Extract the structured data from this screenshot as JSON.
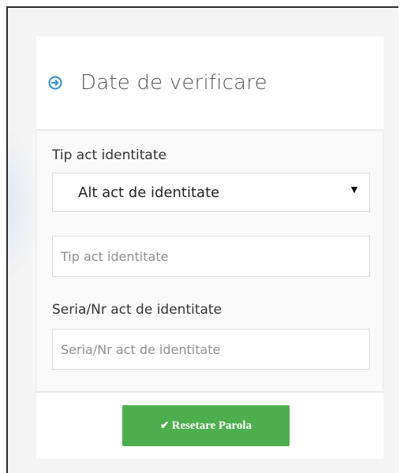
{
  "header": {
    "icon": "arrow-circle-right-icon",
    "title": "Date de verificare",
    "accent_color": "#2f8fd0"
  },
  "form": {
    "id_type_label": "Tip act identitate",
    "id_type_selected": "Alt act de identitate",
    "id_type_input_placeholder": "Tip act identitate",
    "series_label": "Seria/Nr act de identitate",
    "series_input_placeholder": "Seria/Nr act de identitate"
  },
  "footer": {
    "reset_button_label": "Resetare Parola",
    "reset_button_icon": "check-icon",
    "button_color": "#4cae4c"
  }
}
